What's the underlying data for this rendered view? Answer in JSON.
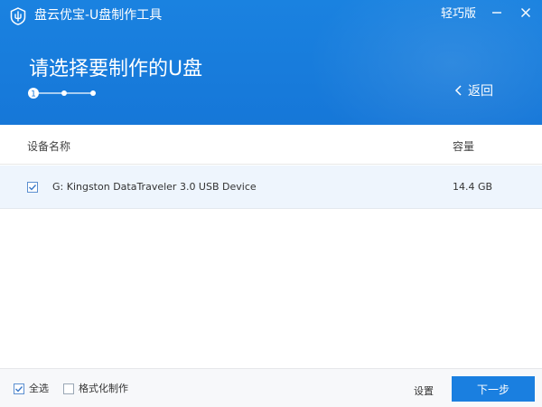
{
  "window": {
    "title": "盘云优宝-U盘制作工具",
    "edition": "轻巧版",
    "logo_icon": "usb-shield-icon",
    "minimize_icon": "minimize-icon",
    "close_icon": "close-icon"
  },
  "header": {
    "page_title": "请选择要制作的U盘",
    "steps": {
      "current": 1,
      "total": 3,
      "current_label": "1"
    },
    "back_label": "返回",
    "back_icon": "chevron-left-icon"
  },
  "table": {
    "columns": [
      "设备名称",
      "容量"
    ],
    "rows": [
      {
        "checked": true,
        "name": "G: Kingston DataTraveler 3.0 USB Device",
        "size": "14.4 GB"
      }
    ]
  },
  "footer": {
    "select_all": {
      "label": "全选",
      "checked": true
    },
    "format_make": {
      "label": "格式化制作",
      "checked": false
    },
    "settings_label": "设置",
    "next_label": "下一步"
  },
  "colors": {
    "header_blue": "#1677d8",
    "button_blue": "#1a7fe0",
    "row_selected": "#eef5fd",
    "footer_bg": "#f7f8fa"
  }
}
